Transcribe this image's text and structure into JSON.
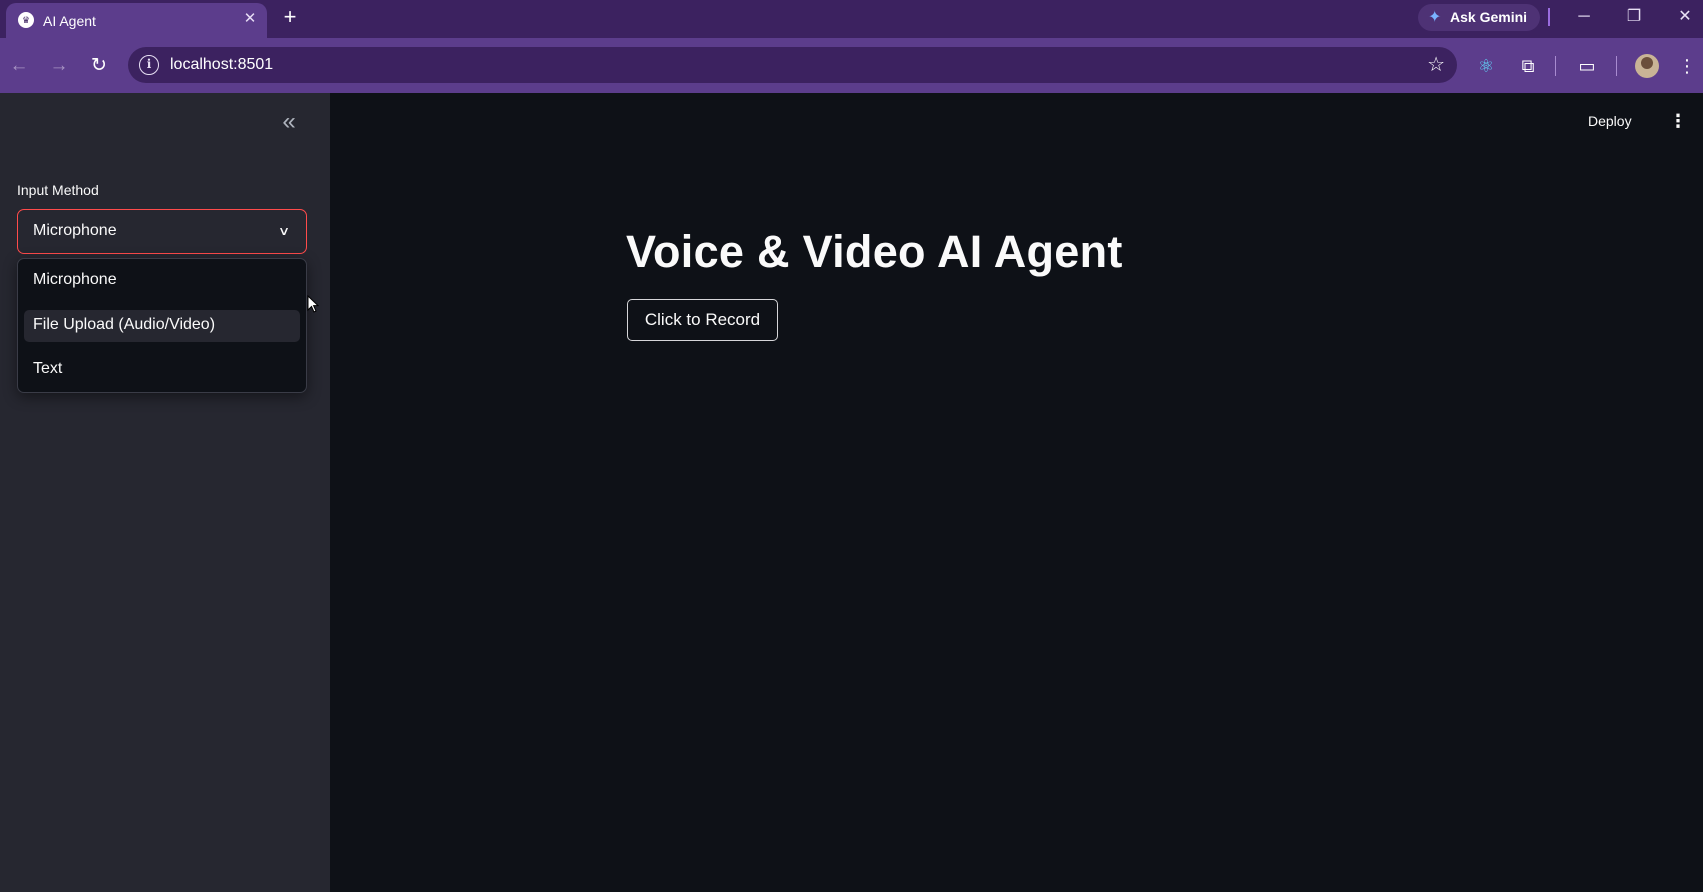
{
  "browser": {
    "tab": {
      "title": "AI Agent",
      "favicon": "streamlit-crown-icon"
    },
    "gemini_label": "Ask Gemini",
    "url": "localhost:8501",
    "icons": {
      "back": "arrow-left-icon",
      "forward": "arrow-right-icon",
      "reload": "reload-icon",
      "site_info": "info-icon",
      "bookmark": "star-icon",
      "extension": "react-devtools-icon",
      "extensions": "puzzle-icon",
      "media": "cast-search-icon",
      "profile": "avatar",
      "menu": "kebab-icon"
    }
  },
  "sidebar": {
    "field_label": "Input Method",
    "select_value": "Microphone",
    "options": [
      "Microphone",
      "File Upload (Audio/Video)",
      "Text"
    ],
    "hovered_option": "File Upload (Audio/Video)"
  },
  "main": {
    "deploy_label": "Deploy",
    "title": "Voice & Video AI Agent",
    "record_button": "Click to Record"
  },
  "colors": {
    "tab_strip": "#3c2260",
    "toolbar": "#5c3d8c",
    "sidebar_bg": "#262730",
    "app_bg": "#0e1117",
    "focus_border": "#ff4b4b",
    "text": "#fafafa"
  }
}
